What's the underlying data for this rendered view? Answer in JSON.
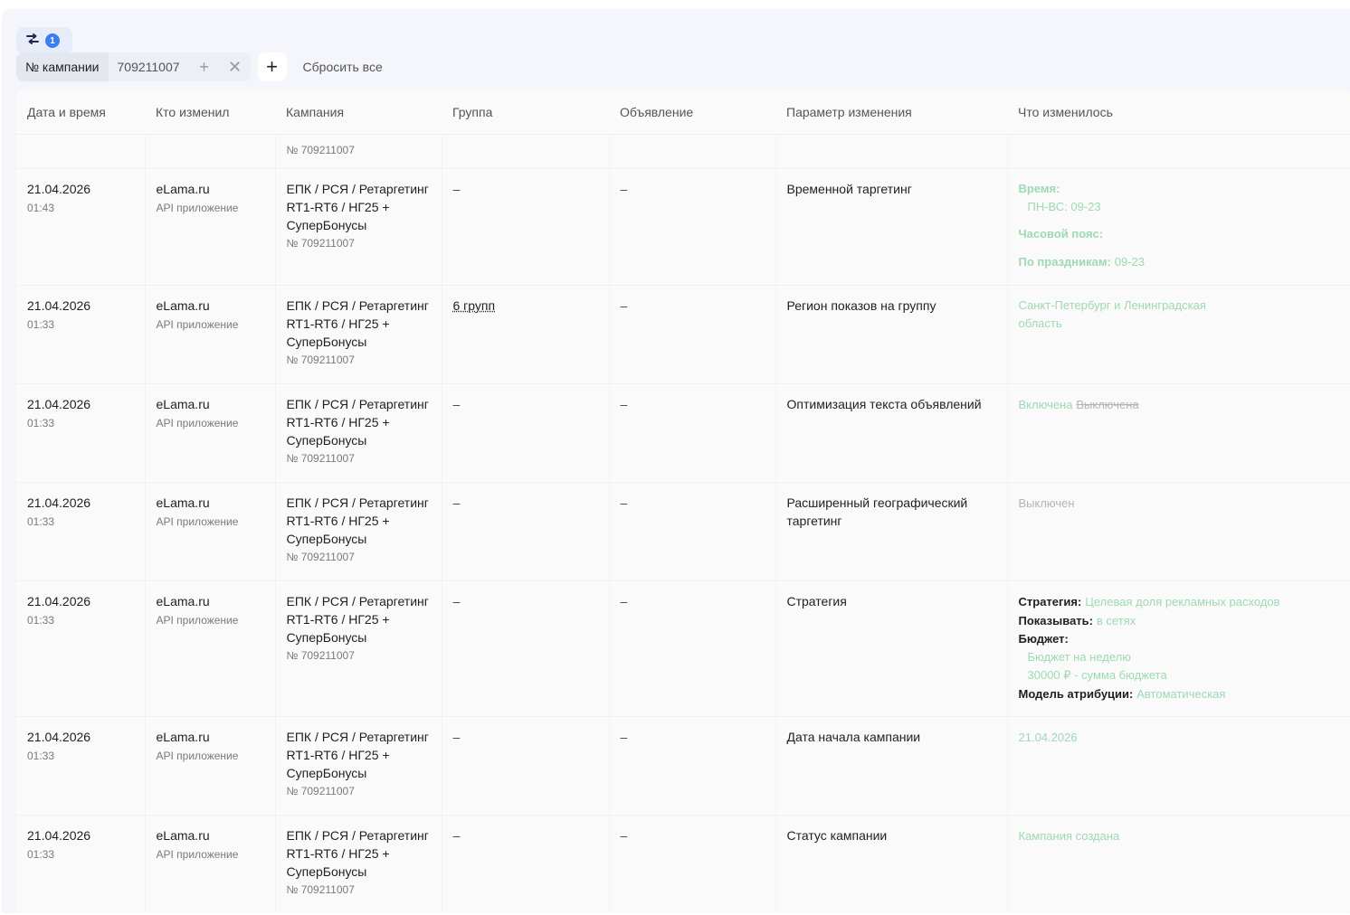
{
  "toolbar": {
    "filter_count": "1",
    "filter_chip": {
      "label": "№ кампании",
      "value": "709211007",
      "add_symbol": "+",
      "remove_symbol": "✕"
    },
    "add_filter_symbol": "+",
    "reset_label": "Сбросить все"
  },
  "table": {
    "headers": {
      "date": "Дата и время",
      "who": "Кто изменил",
      "campaign": "Кампания",
      "group": "Группа",
      "ad": "Объявление",
      "param": "Параметр изменения",
      "what": "Что изменилось"
    },
    "partial_row": {
      "campaign_num": "№ 709211007"
    },
    "rows": [
      {
        "date": "21.04.2026",
        "time": "01:43",
        "who": "eLama.ru",
        "who_sub": "API приложение",
        "campaign": "ЕПК / РСЯ / Ретаргетинг RT1-RT6 / НГ25 + СуперБонусы",
        "campaign_num": "№ 709211007",
        "group": "–",
        "ad": "–",
        "param": "Временной таргетинг",
        "change": {
          "time_label": "Время:",
          "time_value": "ПН-ВС: 09-23",
          "tz_label": "Часовой пояс:",
          "holiday_label": "По праздникам:",
          "holiday_value": "09-23"
        }
      },
      {
        "date": "21.04.2026",
        "time": "01:33",
        "who": "eLama.ru",
        "who_sub": "API приложение",
        "campaign": "ЕПК / РСЯ / Ретаргетинг RT1-RT6 / НГ25 + СуперБонусы",
        "campaign_num": "№ 709211007",
        "group": "6 групп",
        "ad": "–",
        "param": "Регион показов на группу",
        "change": {
          "text": "Санкт-Петербург и Ленинградская область"
        }
      },
      {
        "date": "21.04.2026",
        "time": "01:33",
        "who": "eLama.ru",
        "who_sub": "API приложение",
        "campaign": "ЕПК / РСЯ / Ретаргетинг RT1-RT6 / НГ25 + СуперБонусы",
        "campaign_num": "№ 709211007",
        "group": "–",
        "ad": "–",
        "param": "Оптимизация текста объявлений",
        "change": {
          "new": "Включена",
          "old": "Выключена"
        }
      },
      {
        "date": "21.04.2026",
        "time": "01:33",
        "who": "eLama.ru",
        "who_sub": "API приложение",
        "campaign": "ЕПК / РСЯ / Ретаргетинг RT1-RT6 / НГ25 + СуперБонусы",
        "campaign_num": "№ 709211007",
        "group": "–",
        "ad": "–",
        "param": "Расширенный географический таргетинг",
        "change": {
          "text": "Выключен"
        }
      },
      {
        "date": "21.04.2026",
        "time": "01:33",
        "who": "eLama.ru",
        "who_sub": "API приложение",
        "campaign": "ЕПК / РСЯ / Ретаргетинг RT1-RT6 / НГ25 + СуперБонусы",
        "campaign_num": "№ 709211007",
        "group": "–",
        "ad": "–",
        "param": "Стратегия",
        "change": {
          "strategy_label": "Стратегия:",
          "strategy_value": "Целевая доля рекламных расходов",
          "show_label": "Показывать:",
          "show_value": "в сетях",
          "budget_label": "Бюджет:",
          "budget_line1": "Бюджет на неделю",
          "budget_line2": "30000 ₽ - сумма бюджета",
          "attr_label": "Модель атрибуции:",
          "attr_value": "Автоматическая"
        }
      },
      {
        "date": "21.04.2026",
        "time": "01:33",
        "who": "eLama.ru",
        "who_sub": "API приложение",
        "campaign": "ЕПК / РСЯ / Ретаргетинг RT1-RT6 / НГ25 + СуперБонусы",
        "campaign_num": "№ 709211007",
        "group": "–",
        "ad": "–",
        "param": "Дата начала кампании",
        "change": {
          "text": "21.04.2026"
        }
      },
      {
        "date": "21.04.2026",
        "time": "01:33",
        "who": "eLama.ru",
        "who_sub": "API приложение",
        "campaign": "ЕПК / РСЯ / Ретаргетинг RT1-RT6 / НГ25 + СуперБонусы",
        "campaign_num": "№ 709211007",
        "group": "–",
        "ad": "–",
        "param": "Статус кампании",
        "change": {
          "text": "Кампания создана"
        }
      }
    ]
  },
  "colors": {
    "accent": "#3d7ef0",
    "new_value": "#9ed9b2",
    "old_value": "#b5b5b5"
  }
}
